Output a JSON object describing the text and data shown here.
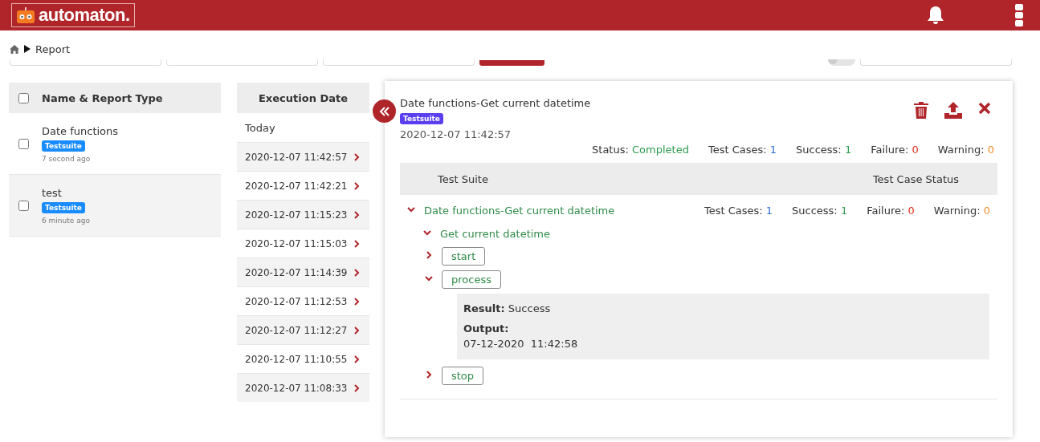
{
  "header": {
    "logo": "automaton."
  },
  "breadcrumb": {
    "current": "Report"
  },
  "filters": {
    "toggle_on": false
  },
  "reports": {
    "columns": [
      "Name & Report Type"
    ],
    "select_all_checked": false,
    "rows": [
      {
        "name": "Date functions",
        "type": "Testsuite",
        "age": "7 second ago",
        "checked": false
      },
      {
        "name": "test",
        "type": "Testsuite",
        "age": "6 minute ago",
        "checked": false
      }
    ]
  },
  "executions": {
    "title": "Execution Date",
    "group": "Today",
    "dates": [
      "2020-12-07 11:42:57",
      "2020-12-07 11:42:21",
      "2020-12-07 11:15:23",
      "2020-12-07 11:15:03",
      "2020-12-07 11:14:39",
      "2020-12-07 11:12:53",
      "2020-12-07 11:12:27",
      "2020-12-07 11:10:55",
      "2020-12-07 11:08:33"
    ]
  },
  "detail": {
    "title": "Date functions-Get current datetime",
    "type": "Testsuite",
    "date": "2020-12-07 11:42:57",
    "summary": [
      {
        "label": "Status:",
        "value": "Completed",
        "kind": "status"
      },
      {
        "label": "Test Cases:",
        "value": "1",
        "kind": "count"
      },
      {
        "label": "Success:",
        "value": "1",
        "kind": "success"
      },
      {
        "label": "Failure:",
        "value": "0",
        "kind": "failure"
      },
      {
        "label": "Warning:",
        "value": "0",
        "kind": "warning"
      }
    ],
    "columns": [
      "Test Suite",
      "Test Case Status"
    ],
    "tree": [
      {
        "label": "Date functions-Get current datetime",
        "expanded": true,
        "stats": [
          {
            "label": "Test Cases:",
            "value": "1",
            "kind": "count"
          },
          {
            "label": "Success:",
            "value": "1",
            "kind": "success"
          },
          {
            "label": "Failure:",
            "value": "0",
            "kind": "failure"
          },
          {
            "label": "Warning:",
            "value": "0",
            "kind": "warning"
          }
        ],
        "children": [
          {
            "label": "Get current datetime",
            "expanded": true,
            "children": [
              {
                "label": "start",
                "expanded": false
              },
              {
                "label": "process",
                "expanded": true,
                "result_label": "Result:",
                "result": "Success",
                "output_label": "Output:",
                "output": "07-12-2020  11:42:58"
              },
              {
                "label": "stop",
                "expanded": false
              }
            ]
          }
        ]
      }
    ]
  }
}
